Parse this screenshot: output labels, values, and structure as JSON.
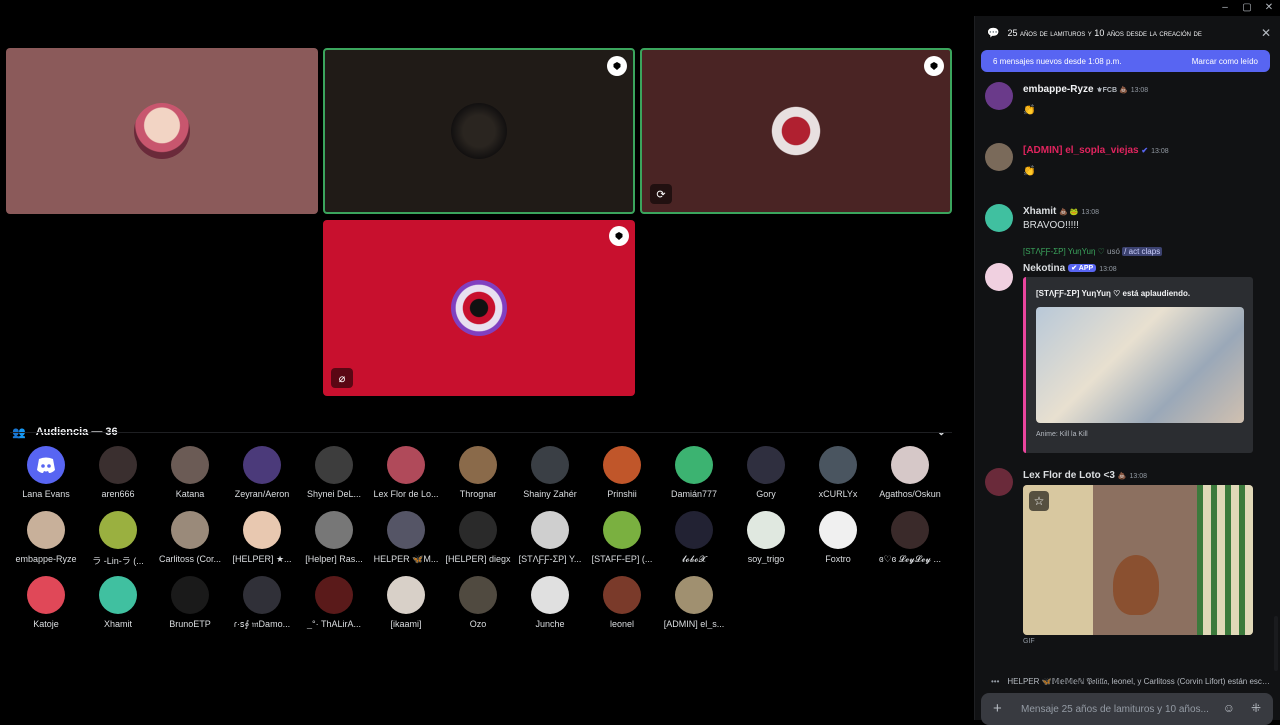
{
  "window": {
    "minimize": "–",
    "maximize": "▢",
    "close": "✕"
  },
  "stage": {
    "tiles": [
      {
        "id": "tile-1",
        "bg": "#8b5a5a",
        "badge": false,
        "mute": false
      },
      {
        "id": "tile-2",
        "bg": "#201b17",
        "badge": true,
        "mute": false,
        "speaking": true
      },
      {
        "id": "tile-3",
        "bg": "#4a2424",
        "badge": true,
        "mute": false,
        "screen": true,
        "speaking": true
      },
      {
        "id": "tile-4",
        "bg": "#c8102e",
        "badge": true,
        "mute": true
      }
    ]
  },
  "audience": {
    "title": "Audiencia — 36",
    "members": [
      "Lana Evans",
      "aren666",
      "Katana",
      "Zeyran/Aeron",
      "Shynei DeL...",
      "Lex Flor de Lo...",
      "Thrognar",
      "Shainy Zahér",
      "Prinshii",
      "Damián777",
      "Gory",
      "xCURLYx",
      "Agathos/Oskun",
      "embappe-Ryze",
      "ラ -Lin-ラ (...",
      "Carlitoss (Cor...",
      "[HELPER] ★...",
      "[Helper] Ras...",
      "HELPER 🦋M...",
      "[HELPER] diegx",
      "[STΛƑƑ-ΣP] Y...",
      "[STAFF-EP] (...",
      "𝓵𝓸𝓫𝓸𝓧",
      "soy_trigo",
      "Foxtro",
      "ɞ♡ɞ 𝓛𝓮𝔂𝓛𝓮𝔂 ...",
      "Katoje",
      "Xhamit",
      "BrunoETP",
      "ɾ·ꜱ∮ 𝔪Damo...",
      "_°· ThALirA...",
      "[ikaami]",
      "Ozo",
      "Junche",
      "leonel",
      "[ADMIN] el_s..."
    ],
    "colors": [
      "#5865f2",
      "#3a2f2f",
      "#6b5b55",
      "#4b3a7a",
      "#3d3d3d",
      "#b04a5a",
      "#8a6a4a",
      "#3a3f45",
      "#c0562a",
      "#3cb371",
      "#2f2f3f",
      "#4a5560",
      "#d6c8c8",
      "#c8b09a",
      "#9ab040",
      "#9a8a7a",
      "#e8c8b0",
      "#777777",
      "#555566",
      "#2a2a2a",
      "#cfcfcf",
      "#7ab040",
      "#222233",
      "#e0e8e0",
      "#f0f0f0",
      "#3a2a2a",
      "#e04858",
      "#40c0a0",
      "#1a1a1a",
      "#303038",
      "#5a1a1a",
      "#d8d0c8",
      "#504a40",
      "#e0e0e0",
      "#7a3a2a",
      "#a09070"
    ]
  },
  "chat": {
    "title": "25 años de lamituros y 10 años desde la creación de",
    "new_messages": "6 mensajes nuevos desde 1:08 p.m.",
    "mark_read": "Marcar como leído",
    "messages": [
      {
        "user": "embappe-Ryze",
        "color": "#f2f3f5",
        "suffix": "⚜FCB 💩",
        "time": "13:08",
        "text": "👏"
      },
      {
        "user": "[ADMIN] el_sopla_viejas",
        "color": "#e0245e",
        "suffix": "✔",
        "time": "13:08",
        "text": "👏"
      },
      {
        "user": "Xhamit",
        "color": "#f2f3f5",
        "suffix": "💩 🐸",
        "time": "13:08",
        "text": "BRAVOO!!!!!"
      },
      {
        "user": "Nekotina",
        "color": "#f2f3f5",
        "suffix": "",
        "app": "✔ APP",
        "time": "13:08",
        "text": ""
      },
      {
        "user": "Lex Flor de Loto <3",
        "color": "#f2f3f5",
        "suffix": "💩",
        "time": "13:08",
        "text": ""
      }
    ],
    "reply": {
      "user": "[STΛƑƑ-ΣP] YuηYuη ♡",
      "used": "usó",
      "command": "/ act claps"
    },
    "embed": {
      "title": "[STΛƑƑ-ΣP] YuηYuη ♡ está aplaudiendo.",
      "footer": "Anime: Kill la Kill"
    },
    "gif_label": "GIF",
    "typing": "HELPER 🦋𝕄𝕖𝕄𝕖ℕ 𝔓𝔬𝔩𝔦𝔩𝔩𝔞, leonel, y Carlitoss (Corvin Lifort) están escribiendo...",
    "composer_placeholder": "Mensaje 25 años de lamituros y 10 años..."
  }
}
